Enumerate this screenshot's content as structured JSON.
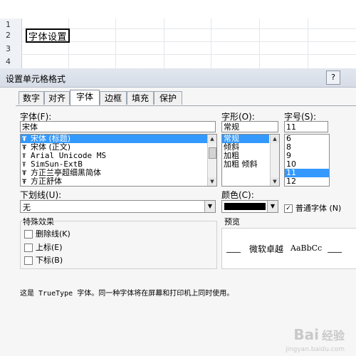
{
  "sheet": {
    "rows": [
      "1",
      "2",
      "3",
      "4"
    ],
    "active_cell_text": "字体设置"
  },
  "dialog": {
    "title": "设置单元格格式",
    "help_label": "?",
    "tabs": [
      {
        "label": "数字",
        "active": false
      },
      {
        "label": "对齐",
        "active": false
      },
      {
        "label": "字体",
        "active": true
      },
      {
        "label": "边框",
        "active": false
      },
      {
        "label": "填充",
        "active": false
      },
      {
        "label": "保护",
        "active": false
      }
    ],
    "font": {
      "label": "字体(F):",
      "value": "宋体",
      "options": [
        "宋体 (标题)",
        "宋体 (正文)",
        "Arial Unicode MS",
        "SimSun-ExtB",
        "方正兰亭超细黑简体",
        "方正舒体"
      ],
      "selected": "宋体 (标题)"
    },
    "style": {
      "label": "字形(O):",
      "value": "常规",
      "options": [
        "常规",
        "倾斜",
        "加粗",
        "加粗 倾斜"
      ],
      "selected": "常规"
    },
    "size": {
      "label": "字号(S):",
      "value": "11",
      "options": [
        "6",
        "8",
        "9",
        "10",
        "11",
        "12"
      ],
      "selected": "11"
    },
    "underline": {
      "label": "下划线(U):",
      "value": "无"
    },
    "color": {
      "label": "颜色(C):",
      "swatch": "#000000"
    },
    "normal_font": {
      "label": "普通字体 (N)",
      "checked": true
    },
    "effects": {
      "title": "特殊效果",
      "items": [
        "删除线(K)",
        "上标(E)",
        "下标(B)"
      ]
    },
    "preview": {
      "label": "预览",
      "sample_cn": "微软卓越",
      "sample_en": "AaBbCc"
    },
    "note": "这是 TrueType 字体。同一种字体将在屏幕和打印机上同时使用。"
  },
  "watermark": {
    "brand": "Bai",
    "suffix": "经验",
    "sub": "jingyan.baidu.com"
  },
  "colors": {
    "selection": "#3399ff",
    "dialog_bg": "#f6f6f6",
    "titlebar": "#d6dce6"
  }
}
